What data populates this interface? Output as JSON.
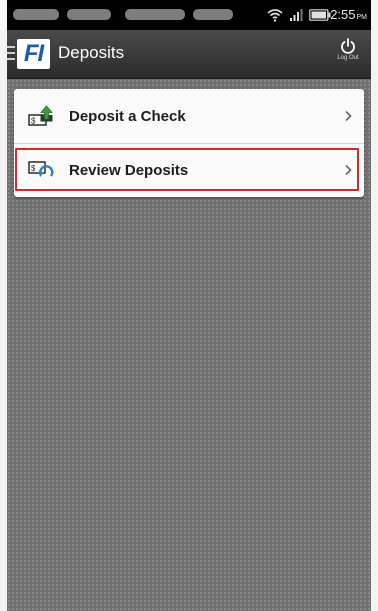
{
  "status_bar": {
    "time": "2:55",
    "time_suffix": "PM",
    "icons": [
      "wifi-icon",
      "signal-icon",
      "battery-icon"
    ]
  },
  "header": {
    "logo_text": "FI",
    "title": "Deposits",
    "logout_label": "Log Out",
    "menu_icon": "hamburger-icon",
    "logout_icon": "power-icon"
  },
  "menu": {
    "items": [
      {
        "label": "Deposit a Check",
        "icon": "deposit-check-icon",
        "highlighted": false
      },
      {
        "label": "Review Deposits",
        "icon": "review-deposits-icon",
        "highlighted": true
      }
    ]
  },
  "colors": {
    "header": "#3a3a3a",
    "highlight": "#d9262a",
    "logo_blue": "#1d5da8",
    "icon_green": "#3a9a3e",
    "icon_blue": "#2f7fc1"
  }
}
